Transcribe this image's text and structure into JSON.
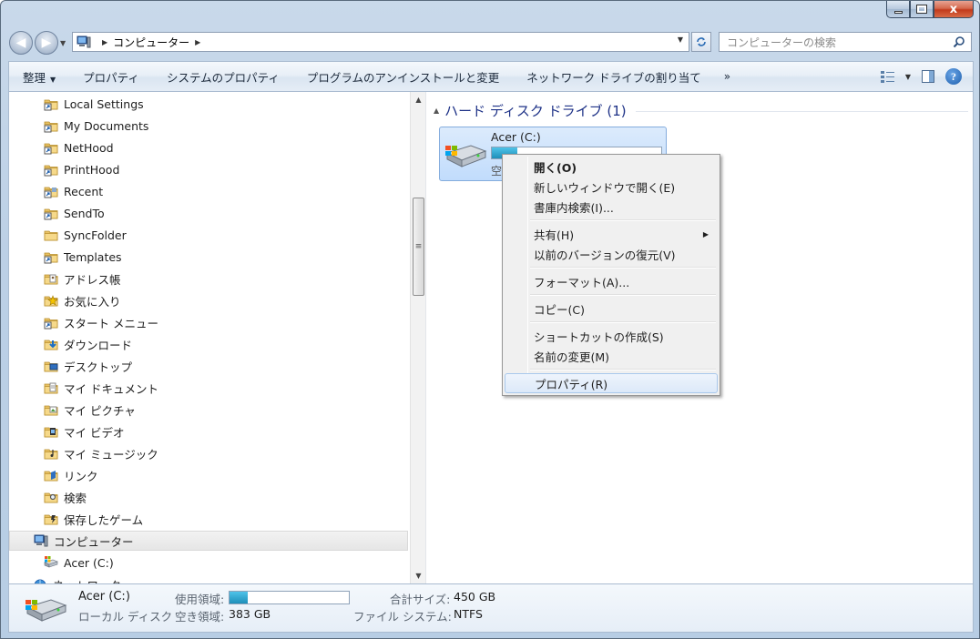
{
  "window": {
    "caption": {
      "minimize": "",
      "maximize": "",
      "close": "x"
    }
  },
  "address": {
    "crumbs": [
      "コンピューター"
    ],
    "search_placeholder": "コンピューターの検索"
  },
  "commands": {
    "organize": "整理",
    "properties": "プロパティ",
    "system_properties": "システムのプロパティ",
    "uninstall": "プログラムのアンインストールと変更",
    "map_drive": "ネットワーク ドライブの割り当て",
    "more": "»"
  },
  "nav_tree": [
    {
      "label": "Local Settings",
      "icon": "shortcut-folder-icon"
    },
    {
      "label": "My Documents",
      "icon": "shortcut-folder-icon"
    },
    {
      "label": "NetHood",
      "icon": "shortcut-folder-icon"
    },
    {
      "label": "PrintHood",
      "icon": "shortcut-folder-icon"
    },
    {
      "label": "Recent",
      "icon": "recent-icon"
    },
    {
      "label": "SendTo",
      "icon": "shortcut-folder-icon"
    },
    {
      "label": "SyncFolder",
      "icon": "folder-icon"
    },
    {
      "label": "Templates",
      "icon": "shortcut-folder-icon"
    },
    {
      "label": "アドレス帳",
      "icon": "contacts-folder-icon"
    },
    {
      "label": "お気に入り",
      "icon": "favorites-folder-icon"
    },
    {
      "label": "スタート メニュー",
      "icon": "shortcut-folder-icon"
    },
    {
      "label": "ダウンロード",
      "icon": "downloads-folder-icon"
    },
    {
      "label": "デスクトップ",
      "icon": "desktop-folder-icon"
    },
    {
      "label": "マイ ドキュメント",
      "icon": "documents-folder-icon"
    },
    {
      "label": "マイ ピクチャ",
      "icon": "pictures-folder-icon"
    },
    {
      "label": "マイ ビデオ",
      "icon": "videos-folder-icon"
    },
    {
      "label": "マイ ミュージック",
      "icon": "music-folder-icon"
    },
    {
      "label": "リンク",
      "icon": "links-folder-icon"
    },
    {
      "label": "検索",
      "icon": "search-folder-icon"
    },
    {
      "label": "保存したゲーム",
      "icon": "games-folder-icon"
    },
    {
      "label": "コンピューター",
      "icon": "computer-icon"
    },
    {
      "label": "Acer (C:)",
      "icon": "drive-icon"
    },
    {
      "label": "ネットワーク",
      "icon": "network-icon"
    }
  ],
  "main": {
    "group_header": "ハード ディスク ドライブ (1)",
    "drive": {
      "name": "Acer (C:)",
      "free_label": "空",
      "used_fraction": 0.15
    }
  },
  "context_menu": [
    {
      "label": "開く(O)",
      "bold": true
    },
    {
      "label": "新しいウィンドウで開く(E)"
    },
    {
      "label": "書庫内検索(I)..."
    },
    {
      "label": "共有(H)",
      "submenu": true
    },
    {
      "label": "以前のバージョンの復元(V)"
    },
    {
      "label": "フォーマット(A)..."
    },
    {
      "label": "コピー(C)"
    },
    {
      "label": "ショートカットの作成(S)"
    },
    {
      "label": "名前の変更(M)"
    },
    {
      "label": "プロパティ(R)",
      "highlighted": true
    }
  ],
  "details": {
    "name": "Acer (C:)",
    "type": "ローカル ディスク",
    "used_label": "使用領域:",
    "free_label": "空き領域:",
    "free_value": "383 GB",
    "total_label": "合計サイズ:",
    "total_value": "450 GB",
    "fs_label": "ファイル システム:",
    "fs_value": "NTFS",
    "used_fraction": 0.15
  },
  "colors": {
    "accent": "#1e3287",
    "selection": "#c1dcfc",
    "usage_bar": "#26a0da"
  }
}
